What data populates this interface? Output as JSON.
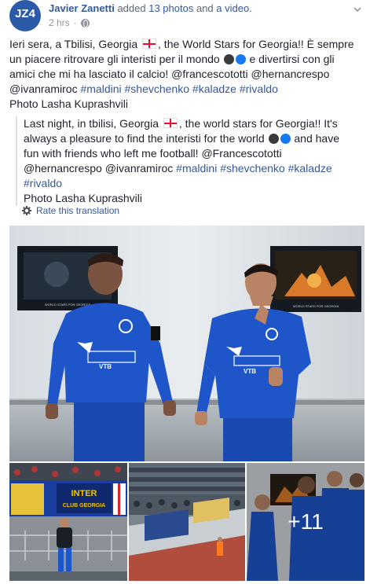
{
  "post": {
    "author": "Javier Zanetti",
    "action_prefix": "added",
    "action_photos": "13 photos",
    "action_and": "and",
    "action_video": "a video.",
    "time": "2 hrs",
    "avatar_text": "JZ4"
  },
  "original": {
    "l1a": "Ieri sera, a Tbilisi, Georgia",
    "l1b": ", the World Stars for Georgia!! È sempre",
    "l2a": "un piacere ritrovare gli interisti per il mondo",
    "l2b": "e divertirsi con gli",
    "l3a": "amici che mi ha lasciato il calcio! @francescototti @hernancrespo",
    "l4a": "@ivanramiroc",
    "l4_tags": [
      "#maldini",
      "#shevchenko",
      "#kaladze",
      "#rivaldo"
    ],
    "l5": "Photo Lasha Kuprashvili"
  },
  "translation": {
    "l1a": "Last night, in tbilisi, Georgia",
    "l1b": ", the world stars for Georgia!! It's",
    "l2a": "always a pleasure to find the interisti for the world",
    "l2b": "and have",
    "l3": "fun with friends who left me football! @Francescototti",
    "l4a": "@hernancrespo @ivanramiroc",
    "l4_tags": [
      "#maldini",
      "#shevchenko",
      "#kaladze"
    ],
    "l5_tag": "#rivaldo",
    "l6": "Photo Lasha Kuprashvili",
    "rate_label": "Rate this translation"
  },
  "photos": {
    "more_count": "+11",
    "banner_line1": "INTER",
    "banner_line2": "CLUB GEORGIA",
    "shirt_sponsor": "VTB",
    "wall_caption": "WORLD STARS FOR GEORGIA"
  },
  "colors": {
    "link": "#365899",
    "text": "#1d2129",
    "meta": "#90949c",
    "kit_blue": "#1e55c8"
  }
}
